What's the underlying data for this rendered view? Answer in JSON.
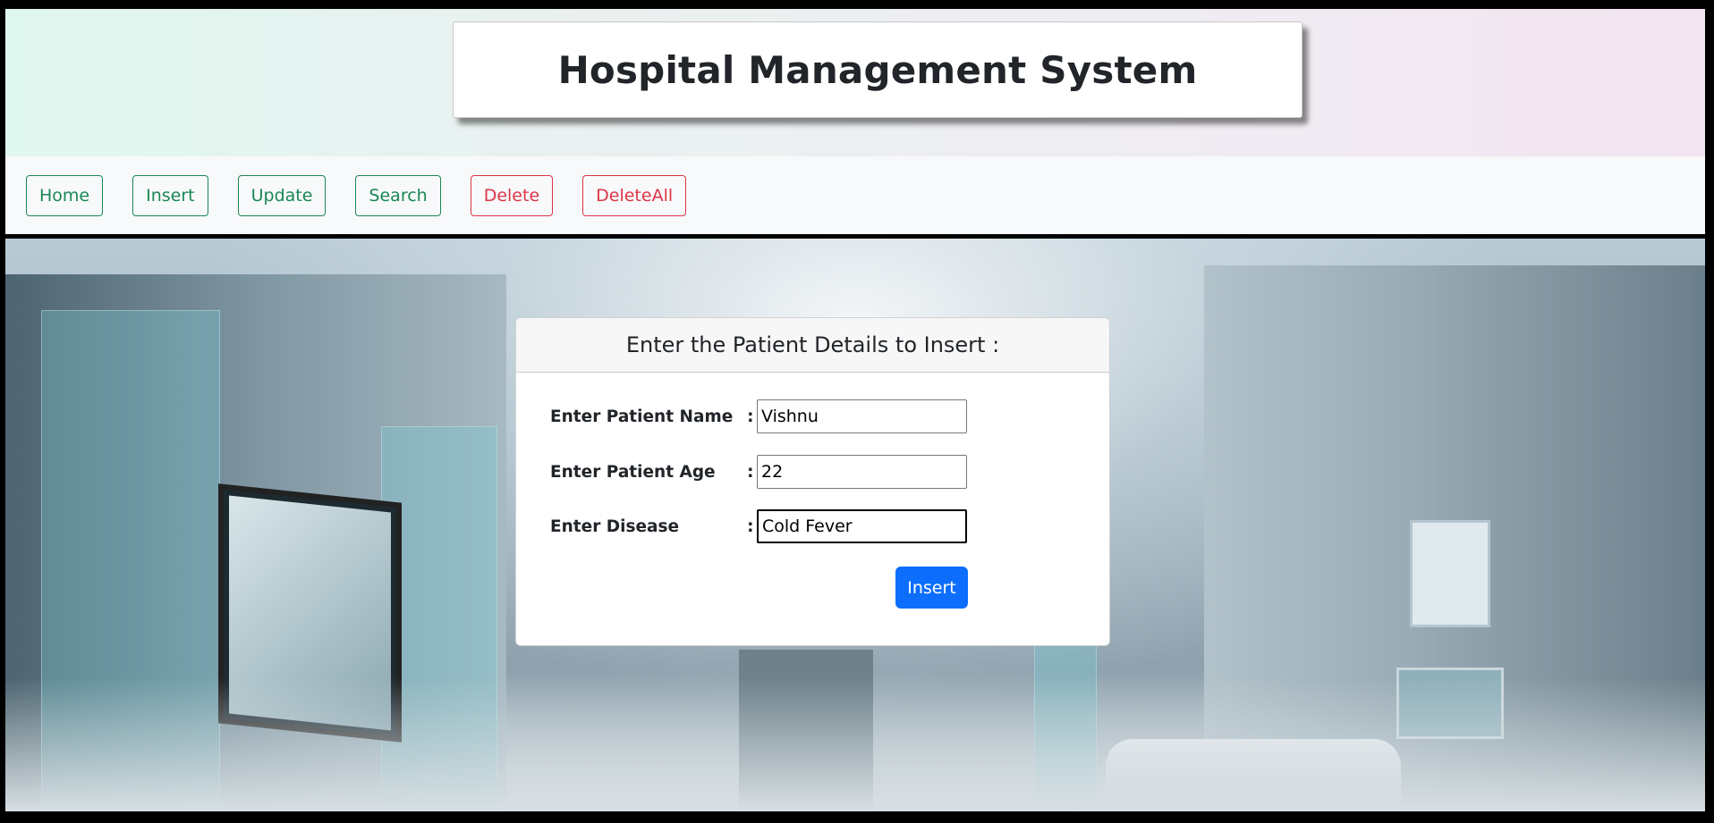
{
  "header": {
    "title": "Hospital Management System"
  },
  "nav": {
    "items": [
      {
        "label": "Home",
        "style": "success"
      },
      {
        "label": "Insert",
        "style": "success"
      },
      {
        "label": "Update",
        "style": "success"
      },
      {
        "label": "Search",
        "style": "success"
      },
      {
        "label": "Delete",
        "style": "danger"
      },
      {
        "label": "DeleteAll",
        "style": "danger"
      }
    ]
  },
  "form": {
    "heading": "Enter the Patient Details to Insert :",
    "separator": ":",
    "fields": [
      {
        "label": "Enter Patient Name",
        "value": "Vishnu"
      },
      {
        "label": "Enter Patient Age",
        "value": "22"
      },
      {
        "label": "Enter Disease",
        "value": "Cold Fever"
      }
    ],
    "submit_label": "Insert"
  },
  "colors": {
    "success": "#198754",
    "danger": "#dc3545",
    "primary": "#0d6efd"
  }
}
